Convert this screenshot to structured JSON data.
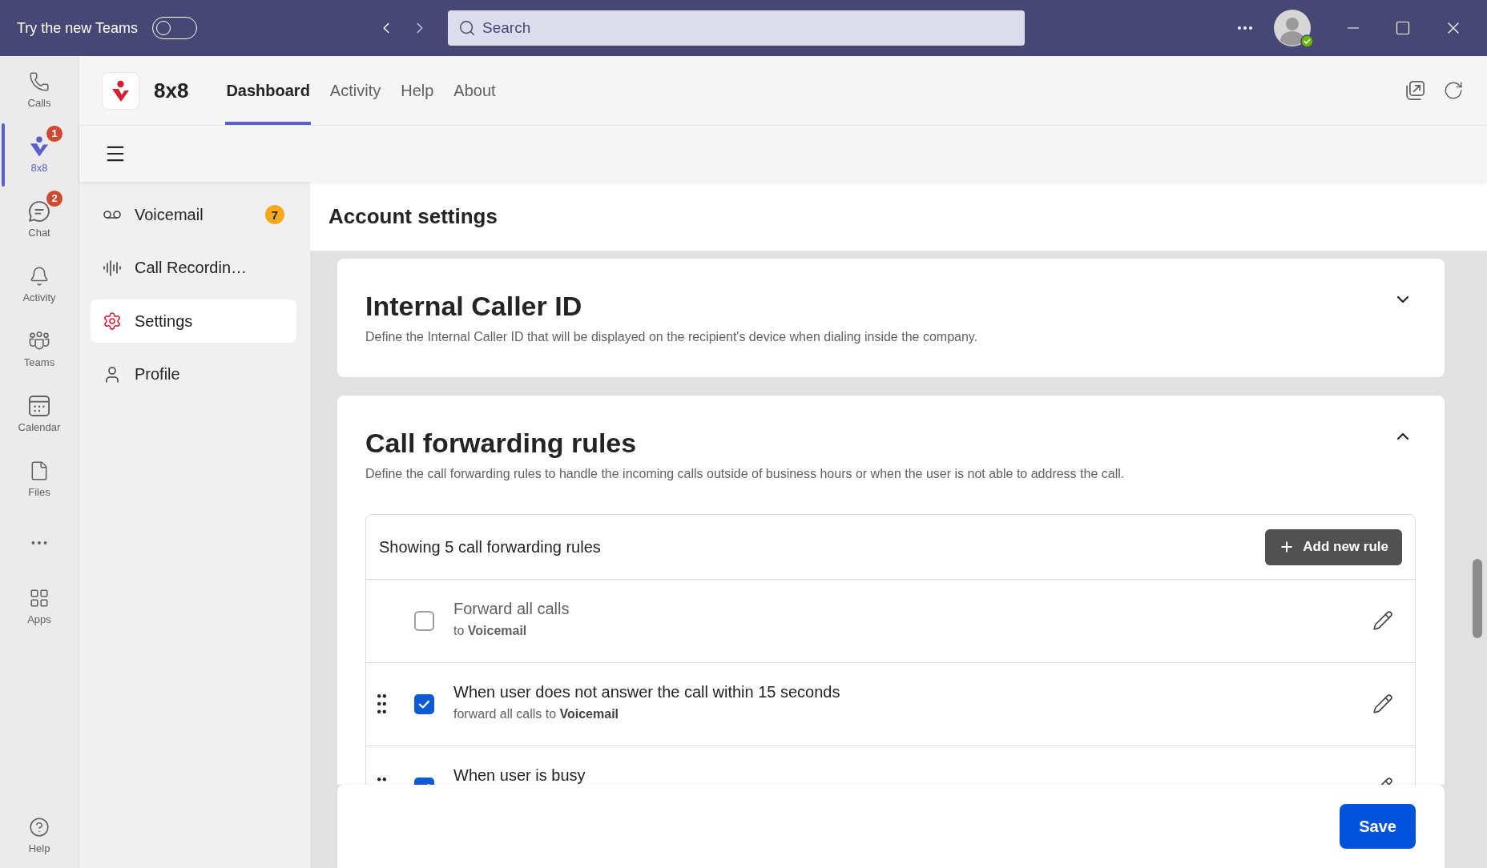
{
  "title_bar": {
    "promo_label": "Try the new Teams",
    "promo_toggle": {
      "on": false
    },
    "search": {
      "placeholder": "Search"
    }
  },
  "rail": {
    "items": [
      {
        "label": "Calls",
        "selected": false
      },
      {
        "label": "8x8",
        "selected": true,
        "badge": "1"
      },
      {
        "label": "Chat",
        "selected": false,
        "badge": "2"
      },
      {
        "label": "Activity",
        "selected": false
      },
      {
        "label": "Teams",
        "selected": false
      },
      {
        "label": "Calendar",
        "selected": false
      },
      {
        "label": "Files",
        "selected": false
      },
      {
        "label": "Apps",
        "selected": false
      }
    ],
    "help": {
      "label": "Help"
    }
  },
  "app_header": {
    "app_name": "8x8",
    "tabs": [
      {
        "label": "Dashboard",
        "selected": true
      },
      {
        "label": "Activity",
        "selected": false
      },
      {
        "label": "Help",
        "selected": false
      },
      {
        "label": "About",
        "selected": false
      }
    ]
  },
  "sidebar": {
    "items": [
      {
        "label": "Voicemail",
        "selected": false,
        "badge": "7"
      },
      {
        "label": "Call Recordin…",
        "selected": false
      },
      {
        "label": "Settings",
        "selected": true
      },
      {
        "label": "Profile",
        "selected": false
      }
    ]
  },
  "page": {
    "title": "Account settings",
    "sections": [
      {
        "title": "Internal Caller ID",
        "description": "Define the Internal Caller ID that will be displayed on the recipient's device when dialing inside the company.",
        "expanded": false
      },
      {
        "title": "Call forwarding rules",
        "description": "Define the call forwarding rules to handle the incoming calls outside of business hours or when the user is not able to address the call.",
        "expanded": true,
        "rules_table": {
          "summary": "Showing 5 call forwarding rules",
          "add_button": "Add new rule",
          "rules": [
            {
              "title": "Forward all calls",
              "detail": "to **Voicemail**",
              "checked": false,
              "draggable": false
            },
            {
              "title": "When user does not answer the call within 15 seconds",
              "detail": "forward all calls to **Voicemail**",
              "checked": true,
              "draggable": true
            },
            {
              "title": "When user is busy",
              "checked": true,
              "draggable": true
            }
          ]
        }
      }
    ],
    "save_button": "Save"
  }
}
